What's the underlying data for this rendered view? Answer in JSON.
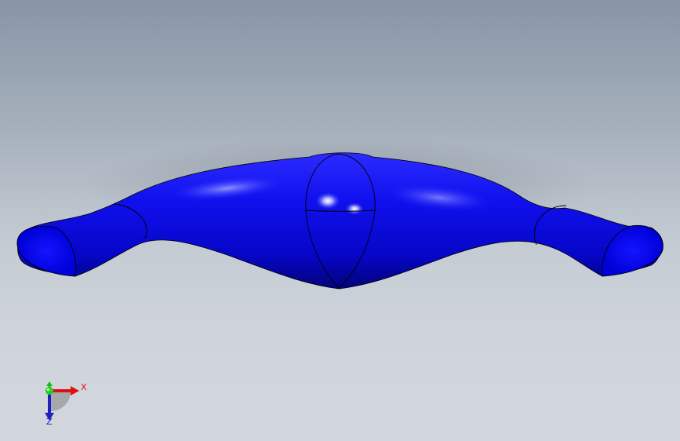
{
  "viewport": {
    "background_top": "#8795a5",
    "background_bottom": "#d2d7dd"
  },
  "model": {
    "color": "#0a00f0",
    "edge_color": "#000000"
  },
  "triad": {
    "x_label": "X",
    "z_label": "Z",
    "x_color": "#e01010",
    "y_color": "#10c010",
    "z_color": "#2020c0"
  }
}
